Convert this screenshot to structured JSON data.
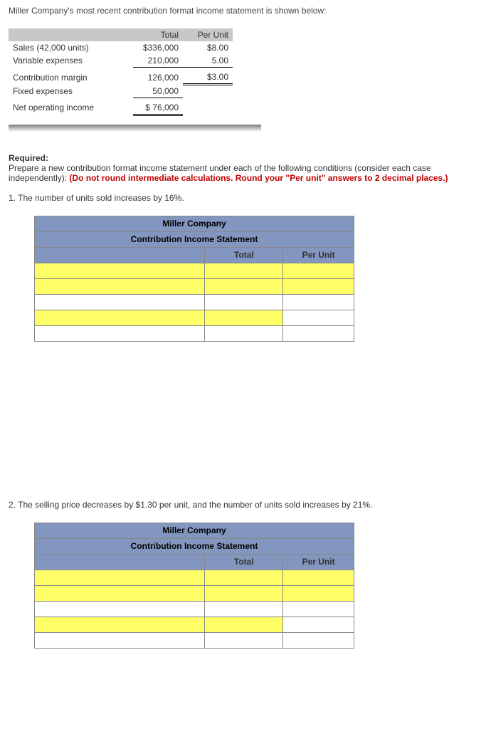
{
  "intro": "Miller Company's most recent contribution format income statement is shown below:",
  "stmt": {
    "headers": {
      "total": "Total",
      "per_unit": "Per Unit"
    },
    "rows": {
      "sales": {
        "label": "Sales (42,000 units)",
        "total": "$336,000",
        "pu": "$8.00"
      },
      "varexp": {
        "label": "Variable expenses",
        "total": "210,000",
        "pu": "5.00"
      },
      "cm": {
        "label": "Contribution margin",
        "total": "126,000",
        "pu": "$3.00"
      },
      "fixed": {
        "label": "Fixed expenses",
        "total": "50,000",
        "pu": ""
      },
      "noi": {
        "label": "Net operating income",
        "total": "$ 76,000",
        "pu": ""
      }
    }
  },
  "required": {
    "label": "Required:",
    "text": "Prepare a new contribution format income statement under each of the following conditions (consider each case independently): ",
    "red": "(Do not round intermediate calculations. Round your \"Per unit\" answers to 2 decimal places.)"
  },
  "q1": "1.  The number of units sold increases by 16%.",
  "q2": "2.  The selling price decreases by $1.30 per unit, and the number of units sold increases by 21%.",
  "ans_table": {
    "company": "Miller Company",
    "title": "Contribution Income Statement",
    "total_hdr": "Total",
    "pu_hdr": "Per Unit"
  }
}
